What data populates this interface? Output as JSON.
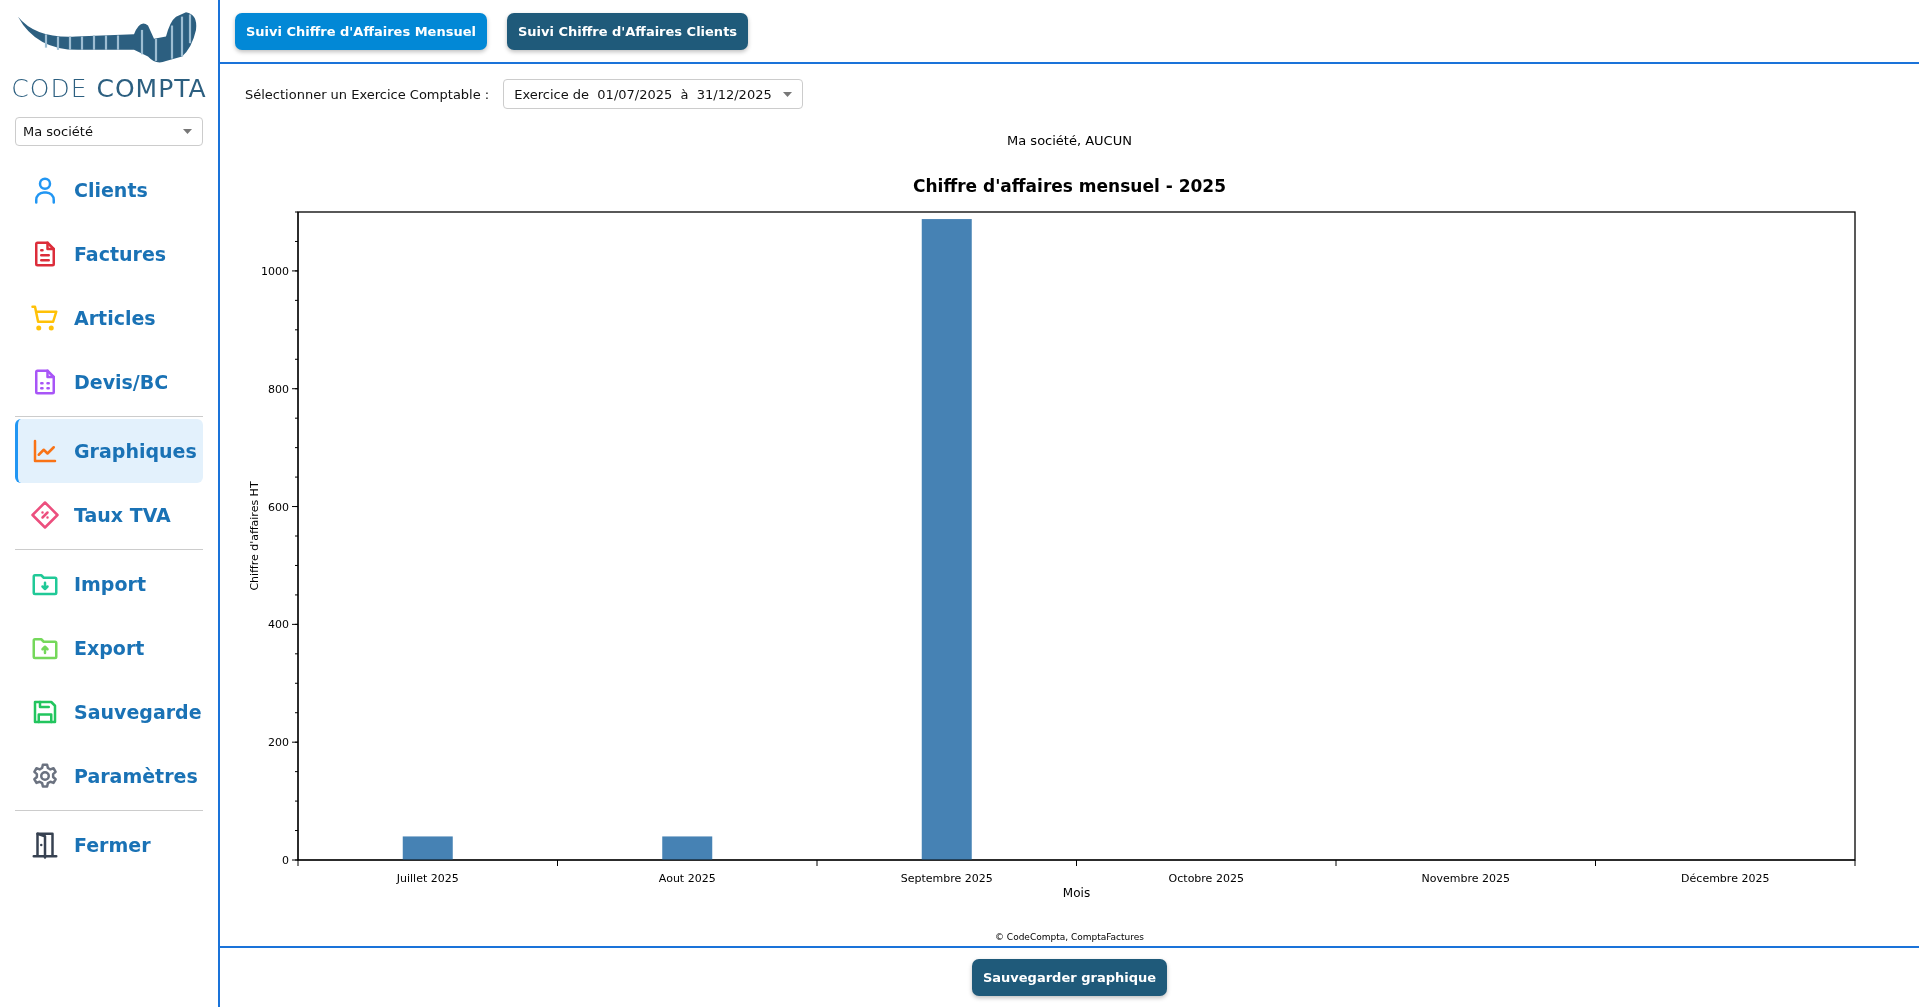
{
  "sidebar": {
    "logo": "CODE **COMPTA**",
    "company_select": {
      "value": "Ma société"
    },
    "sections": [
      {
        "items": [
          {
            "label": "Clients",
            "selected": false
          },
          {
            "label": "Factures",
            "selected": false
          },
          {
            "label": "Articles",
            "selected": false
          },
          {
            "label": "Devis/BC",
            "selected": false
          }
        ]
      },
      {
        "items": [
          {
            "label": "Graphiques",
            "selected": true
          },
          {
            "label": "Taux TVA",
            "selected": false
          }
        ]
      },
      {
        "items": [
          {
            "label": "Import",
            "selected": false
          },
          {
            "label": "Export",
            "selected": false
          },
          {
            "label": "Sauvegarde",
            "selected": false
          },
          {
            "label": "Paramètres",
            "selected": false
          }
        ]
      },
      {
        "items": [
          {
            "label": "Fermer",
            "selected": false
          }
        ]
      }
    ]
  },
  "tabs": [
    {
      "label": "Suivi Chiffre d'Affaires Mensuel",
      "selected": true
    },
    {
      "label": "Suivi Chiffre d'Affaires Clients",
      "selected": false
    }
  ],
  "period": {
    "label": "Sélectionner un Exercice Comptable :",
    "value": "Exercice de  01/07/2025  à  31/12/2025"
  },
  "chart_subtitle": "Ma société, AUCUN",
  "chart_data": {
    "type": "bar",
    "title": "Chiffre d'affaires mensuel - 2025",
    "xlabel": "Mois",
    "ylabel": "Chiffre d'affaires HT",
    "categories": [
      "Juillet 2025",
      "Aout 2025",
      "Septembre 2025",
      "Octobre 2025",
      "Novembre 2025",
      "Décembre 2025"
    ],
    "values": [
      40,
      40,
      1088,
      0,
      0,
      0
    ],
    "ylim": [
      0,
      1100
    ],
    "yticks": [
      0,
      200,
      400,
      600,
      800,
      1000
    ]
  },
  "copyright": "© CodeCompta, ComptaFactures",
  "save_button": "Sauvegarder graphique"
}
